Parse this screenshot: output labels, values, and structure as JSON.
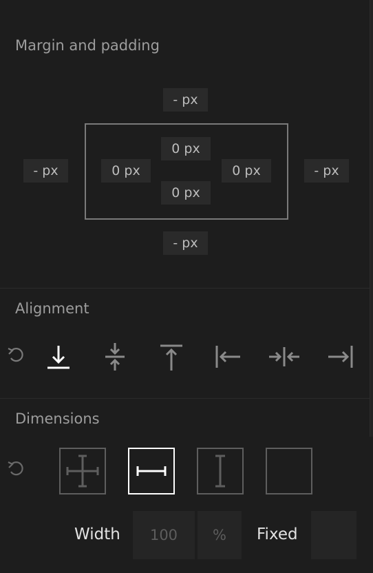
{
  "margin_padding": {
    "title": "Margin and padding",
    "margin": {
      "top": "- px",
      "right": "- px",
      "bottom": "- px",
      "left": "- px"
    },
    "padding": {
      "top": "0 px",
      "right": "0 px",
      "bottom": "0 px",
      "left": "0 px"
    }
  },
  "alignment": {
    "title": "Alignment",
    "reset_icon": "reset-icon",
    "options": [
      {
        "name": "align-bottom",
        "icon": "align-bottom-icon",
        "active": true
      },
      {
        "name": "align-center-vertical",
        "icon": "align-center-vertical-icon",
        "active": false
      },
      {
        "name": "align-top",
        "icon": "align-top-icon",
        "active": false
      },
      {
        "name": "align-left",
        "icon": "align-left-icon",
        "active": false
      },
      {
        "name": "align-center-horizontal",
        "icon": "align-center-horizontal-icon",
        "active": false
      },
      {
        "name": "align-right",
        "icon": "align-right-icon",
        "active": false
      }
    ]
  },
  "dimensions": {
    "title": "Dimensions",
    "options": [
      {
        "name": "stretch-both",
        "icon": "stretch-both-icon",
        "active": false
      },
      {
        "name": "stretch-width",
        "icon": "stretch-width-icon",
        "active": true
      },
      {
        "name": "stretch-height",
        "icon": "stretch-height-icon",
        "active": false
      },
      {
        "name": "fixed-size",
        "icon": "empty-square-icon",
        "active": false
      }
    ],
    "width_label": "Width",
    "width_placeholder": "100",
    "width_unit": "%",
    "fixed_label": "Fixed",
    "fixed_value": ""
  },
  "colors": {
    "background": "#1d1d1d",
    "chip": "#2a2a2a",
    "active": "#ffffff",
    "inactive": "#7a7a7a"
  }
}
